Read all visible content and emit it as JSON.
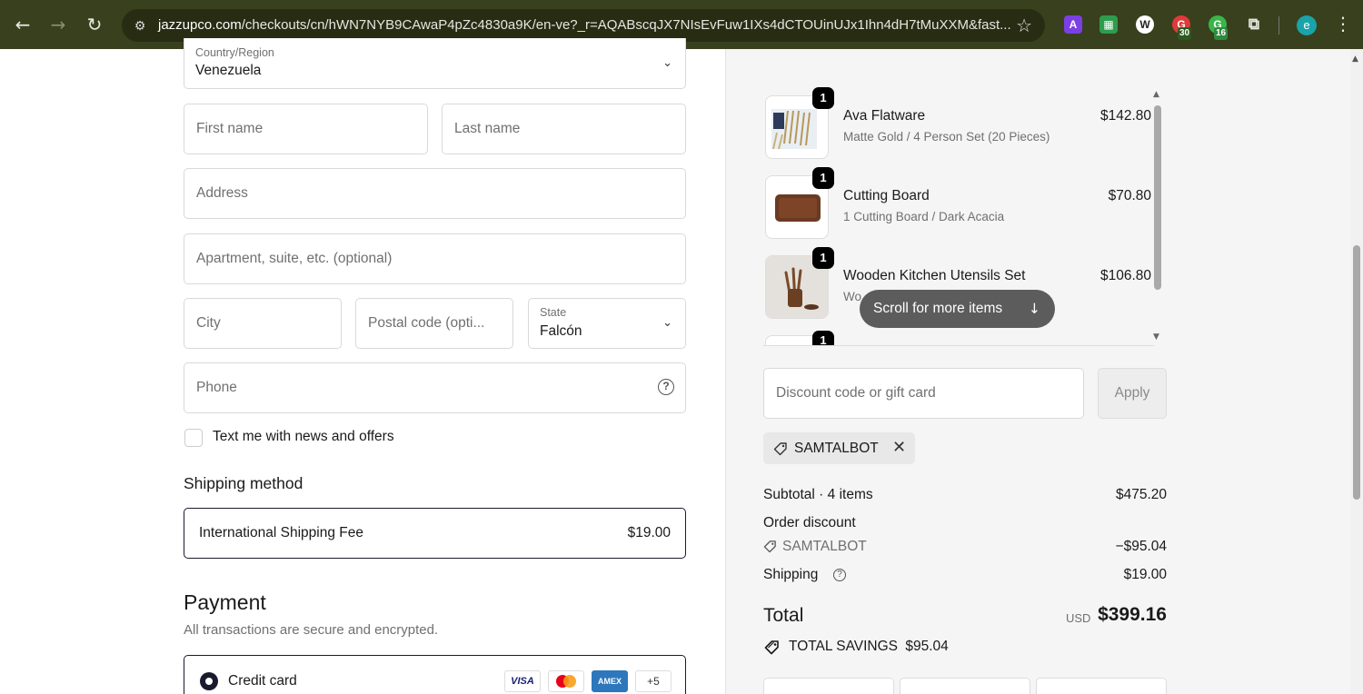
{
  "browser": {
    "url_host": "jazzupco.com",
    "url_path": "/checkouts/cn/hWN7NYB9CAwaP4pZc4830a9K/en-ve?_r=AQABscqJX7NIsEvFuw1IXs4dCTOUinUJx1Ihn4dH7tMuXXM&fast...",
    "ext_badge_1": "30",
    "ext_badge_2": "16",
    "profile_initial": "e"
  },
  "form": {
    "country_label": "Country/Region",
    "country_value": "Venezuela",
    "first_name_placeholder": "First name",
    "last_name_placeholder": "Last name",
    "address_placeholder": "Address",
    "apartment_placeholder": "Apartment, suite, etc. (optional)",
    "city_placeholder": "City",
    "postal_placeholder": "Postal code (opti...",
    "state_label": "State",
    "state_value": "Falcón",
    "phone_placeholder": "Phone",
    "sms_optin_label": "Text me with news and offers"
  },
  "shipping": {
    "heading": "Shipping method",
    "method_name": "International Shipping Fee",
    "method_price": "$19.00"
  },
  "payment": {
    "heading": "Payment",
    "subheading": "All transactions are secure and encrypted.",
    "option_label": "Credit card",
    "cards": [
      "VISA",
      "MC",
      "AMEX",
      "+5"
    ]
  },
  "cart": {
    "items": [
      {
        "qty": "1",
        "name": "Ava Flatware",
        "variant": "Matte Gold / 4 Person Set (20 Pieces)",
        "price": "$142.80"
      },
      {
        "qty": "1",
        "name": "Cutting Board",
        "variant": "1 Cutting Board / Dark Acacia",
        "price": "$70.80"
      },
      {
        "qty": "1",
        "name": "Wooden Kitchen Utensils Set",
        "variant": "Wo",
        "price": "$106.80"
      },
      {
        "qty": "1"
      }
    ],
    "scroll_hint": "Scroll for more items"
  },
  "discount": {
    "placeholder": "Discount code or gift card",
    "apply_label": "Apply",
    "applied_code": "SAMTALBOT"
  },
  "summary": {
    "subtotal_label": "Subtotal · 4 items",
    "subtotal_value": "$475.20",
    "order_discount_label": "Order discount",
    "discount_code": "SAMTALBOT",
    "discount_value": "−$95.04",
    "shipping_label": "Shipping",
    "shipping_value": "$19.00",
    "total_label": "Total",
    "currency": "USD",
    "total_value": "$399.16",
    "savings_label": "TOTAL SAVINGS",
    "savings_value": "$95.04"
  }
}
